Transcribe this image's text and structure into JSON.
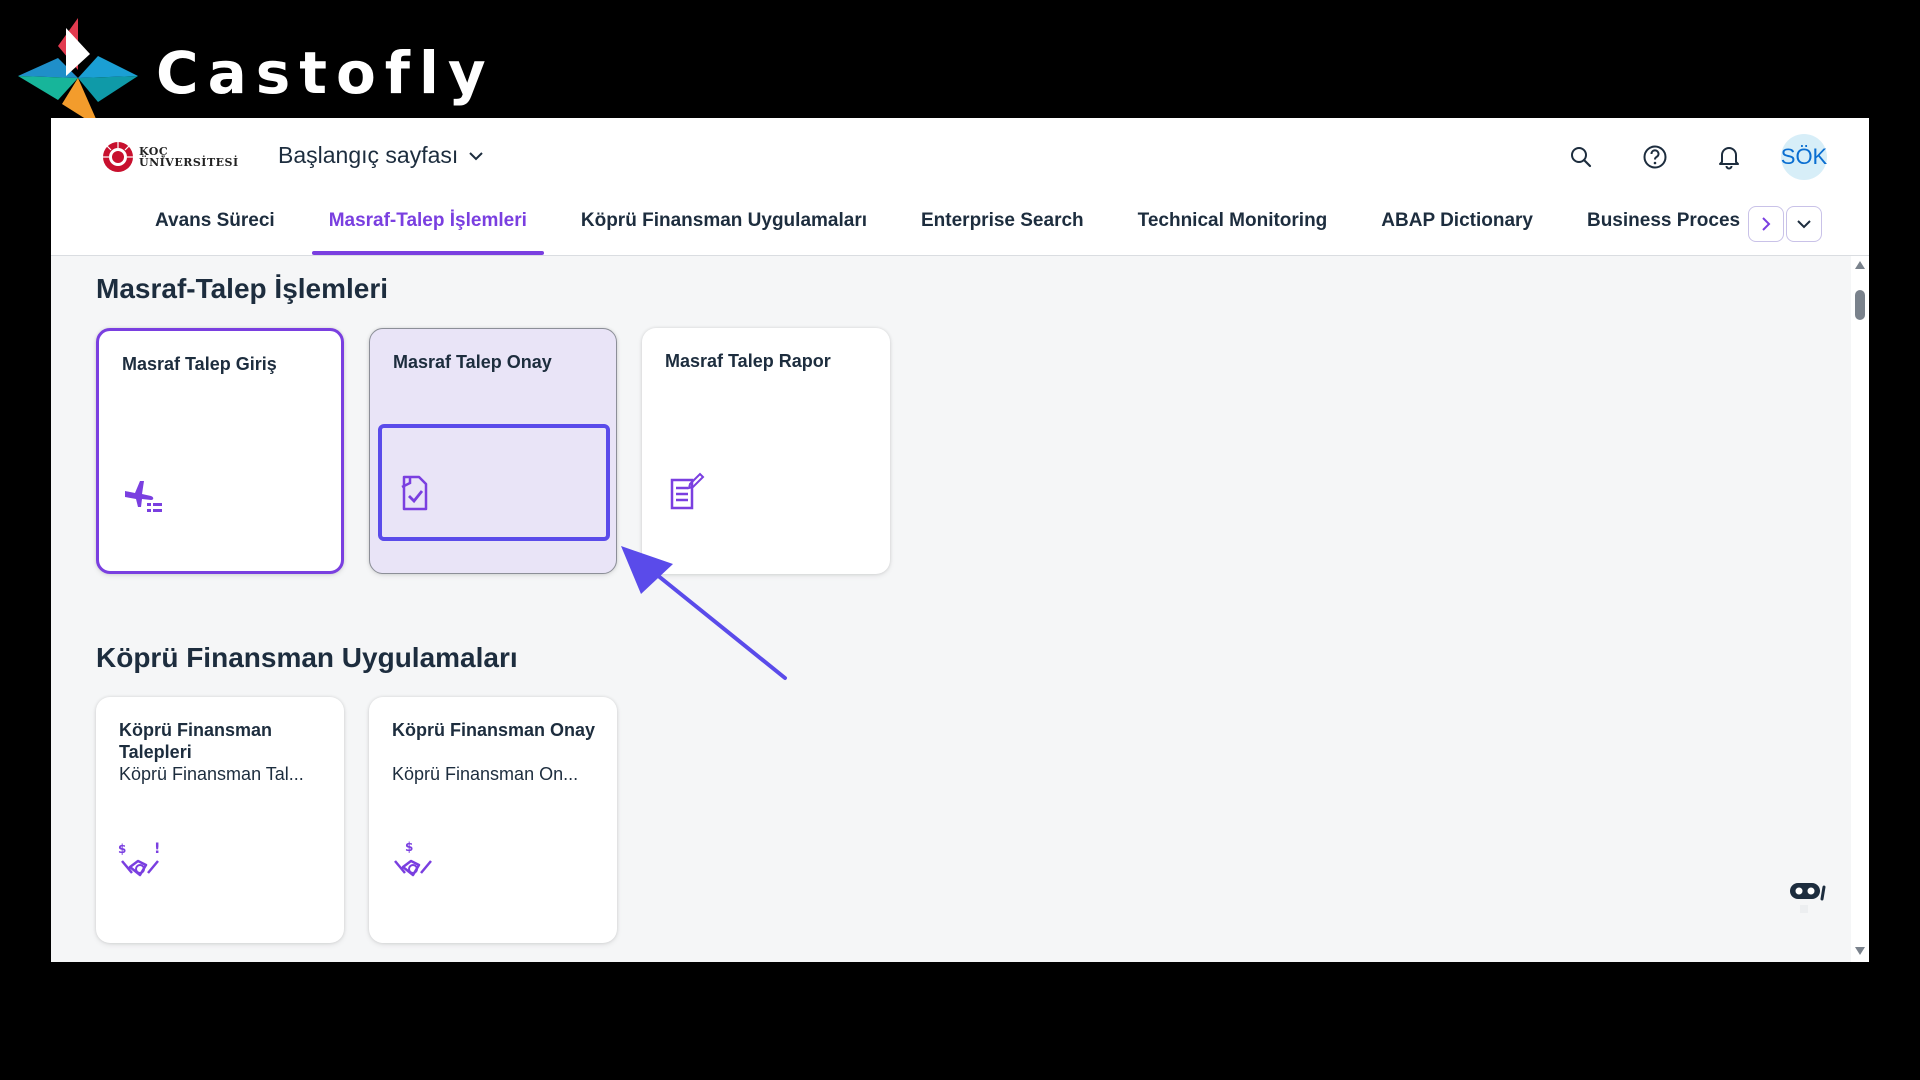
{
  "watermark": {
    "brand": "Castofly"
  },
  "shell": {
    "logo_line1": "KOÇ",
    "logo_line2": "ÜNİVERSİTESİ",
    "home_title": "Başlangıç sayfası",
    "avatar_initials": "SÖK"
  },
  "tabs": [
    {
      "label": "Avans Süreci"
    },
    {
      "label": "Masraf-Talep İşlemleri",
      "active": true
    },
    {
      "label": "Köprü Finansman Uygulamaları"
    },
    {
      "label": "Enterprise Search"
    },
    {
      "label": "Technical Monitoring"
    },
    {
      "label": "ABAP Dictionary"
    },
    {
      "label": "Business Proces"
    }
  ],
  "sections": [
    {
      "title": "Masraf-Talep İşlemleri",
      "tiles": [
        {
          "title": "Masraf Talep Giriş",
          "icon": "plane-list-icon"
        },
        {
          "title": "Masraf Talep Onay",
          "icon": "document-check-icon"
        },
        {
          "title": "Masraf Talep Rapor",
          "icon": "document-edit-icon"
        }
      ]
    },
    {
      "title": "Köprü Finansman Uygulamaları",
      "tiles": [
        {
          "title": "Köprü Finansman Talepleri",
          "subtitle": "Köprü Finansman Tal...",
          "icon": "handshake-money-icon"
        },
        {
          "title": "Köprü Finansman Onay",
          "subtitle": "Köprü Finansman On...",
          "icon": "handshake-money-icon"
        }
      ]
    }
  ],
  "colors": {
    "accent": "#7a3fe0",
    "annotation": "#5a4bea",
    "text": "#1d2d3e"
  }
}
